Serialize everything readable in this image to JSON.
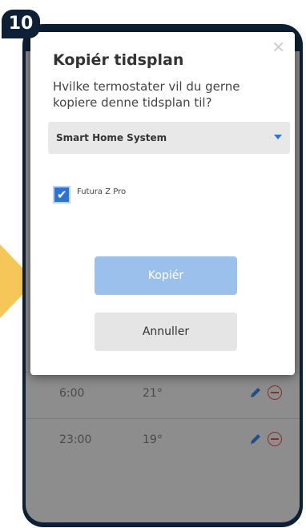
{
  "step": {
    "number": "10"
  },
  "modal": {
    "close_symbol": "×",
    "title": "Kopiér tidsplan",
    "question": "Hvilke termostater vil du gerne kopiere denne tidsplan til?",
    "select": {
      "value": "Smart Home System"
    },
    "thermostats": [
      {
        "label": "Futura Z Pro",
        "checked": true
      }
    ],
    "copy_button": "Kopiér",
    "cancel_button": "Annuller"
  },
  "schedule": {
    "rows": [
      {
        "time": "6:00",
        "temp": "21°"
      },
      {
        "time": "23:00",
        "temp": "19°"
      }
    ]
  },
  "colors": {
    "accent": "#2e72d2",
    "phone": "#0e2036",
    "arrow": "#f6c758",
    "delete": "#8a2d2d"
  },
  "icons": {
    "close": "close-icon",
    "edit": "pencil-icon",
    "delete": "minus-circle-icon",
    "dropdown": "chevron-down-icon"
  }
}
